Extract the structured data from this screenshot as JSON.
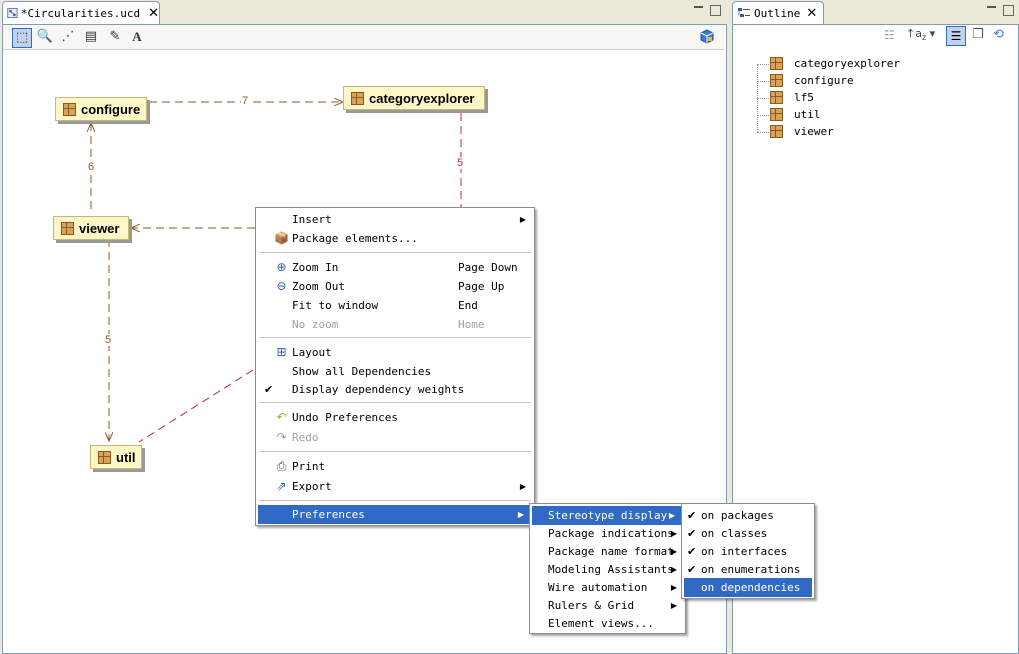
{
  "editor": {
    "tab_title": "*Circularities.ucd",
    "close_icon": "close-icon",
    "toolbar": [
      "select-icon",
      "zoom-icon",
      "dependency-icon",
      "note-icon",
      "note-link-icon",
      "text-icon"
    ]
  },
  "diagram": {
    "nodes": {
      "configure": "configure",
      "categoryexplorer": "categoryexplorer",
      "viewer": "viewer",
      "util": "util"
    },
    "weights": {
      "configure_to_categoryexplorer": "7",
      "categoryexplorer_down": "5",
      "viewer_to_configure": "6",
      "viewer_to_util": "5"
    }
  },
  "context_menu": {
    "items": [
      {
        "label": "Insert",
        "submenu": true
      },
      {
        "label": "Package elements...",
        "icon": "package-elements-icon"
      },
      {
        "label": "Zoom In",
        "accel": "Page Down",
        "icon": "zoom-in-icon"
      },
      {
        "label": "Zoom Out",
        "accel": "Page Up",
        "icon": "zoom-out-icon"
      },
      {
        "label": "Fit to window",
        "accel": "End"
      },
      {
        "label": "No zoom",
        "accel": "Home",
        "disabled": true
      },
      {
        "label": "Layout",
        "icon": "layout-icon"
      },
      {
        "label": "Show all Dependencies"
      },
      {
        "label": "Display dependency weights",
        "checked": true
      },
      {
        "label": "Undo Preferences",
        "icon": "undo-icon"
      },
      {
        "label": "Redo",
        "icon": "redo-icon",
        "disabled": true
      },
      {
        "label": "Print",
        "icon": "print-icon"
      },
      {
        "label": "Export",
        "icon": "export-icon",
        "submenu": true
      },
      {
        "label": "Preferences",
        "submenu": true,
        "highlighted": true
      }
    ]
  },
  "preferences_menu": {
    "items": [
      {
        "label": "Stereotype display",
        "submenu": true,
        "highlighted": true
      },
      {
        "label": "Package indications",
        "submenu": true
      },
      {
        "label": "Package name format",
        "submenu": true
      },
      {
        "label": "Modeling Assistants",
        "submenu": true
      },
      {
        "label": "Wire automation",
        "submenu": true
      },
      {
        "label": "Rulers & Grid",
        "submenu": true
      },
      {
        "label": "Element views..."
      }
    ]
  },
  "stereotype_menu": {
    "items": [
      {
        "label": "on packages",
        "checked": true
      },
      {
        "label": "on classes",
        "checked": true
      },
      {
        "label": "on interfaces",
        "checked": true
      },
      {
        "label": "on enumerations",
        "checked": true
      },
      {
        "label": "on dependencies",
        "checked": false,
        "highlighted": true
      }
    ]
  },
  "outline": {
    "tab_title": "Outline",
    "items": [
      "categoryexplorer",
      "configure",
      "lf5",
      "util",
      "viewer"
    ]
  },
  "colors": {
    "selection": "#316ac5",
    "node_fill": "#fcf6c8",
    "dependency": "#8b5a2b",
    "cycle_dependency": "#c0283c"
  }
}
